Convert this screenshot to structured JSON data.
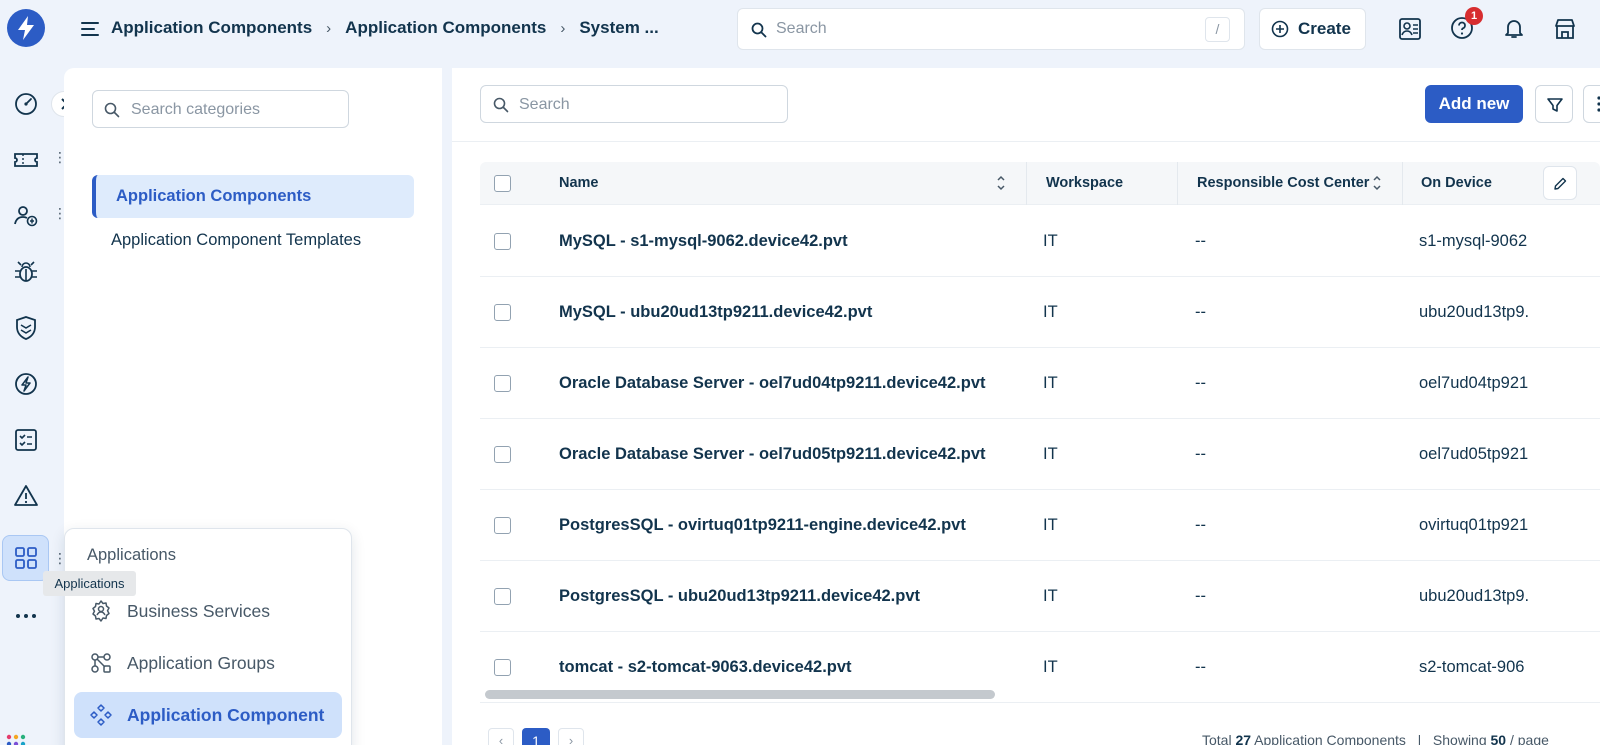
{
  "topbar": {
    "breadcrumb": [
      "Application Components",
      "Application Components",
      "System ..."
    ],
    "search_placeholder": "Search",
    "search_shortcut": "/",
    "create_label": "Create",
    "help_badge_count": "1"
  },
  "categories": {
    "search_placeholder": "Search categories",
    "items": [
      {
        "label": "Application Components",
        "active": true
      },
      {
        "label": "Application Component Templates",
        "active": false
      }
    ]
  },
  "main": {
    "search_placeholder": "Search",
    "add_new_label": "Add new",
    "columns": [
      "Name",
      "Workspace",
      "Responsible Cost Center",
      "On Device"
    ],
    "rows": [
      {
        "name": "MySQL - s1-mysql-9062.device42.pvt",
        "workspace": "IT",
        "cost_center": "--",
        "on_device": "s1-mysql-9062"
      },
      {
        "name": "MySQL - ubu20ud13tp9211.device42.pvt",
        "workspace": "IT",
        "cost_center": "--",
        "on_device": "ubu20ud13tp9."
      },
      {
        "name": "Oracle Database Server - oel7ud04tp9211.device42.pvt",
        "workspace": "IT",
        "cost_center": "--",
        "on_device": "oel7ud04tp921"
      },
      {
        "name": "Oracle Database Server - oel7ud05tp9211.device42.pvt",
        "workspace": "IT",
        "cost_center": "--",
        "on_device": "oel7ud05tp921"
      },
      {
        "name": "PostgresSQL - ovirtuq01tp9211-engine.device42.pvt",
        "workspace": "IT",
        "cost_center": "--",
        "on_device": "ovirtuq01tp921"
      },
      {
        "name": "PostgresSQL - ubu20ud13tp9211.device42.pvt",
        "workspace": "IT",
        "cost_center": "--",
        "on_device": "ubu20ud13tp9."
      },
      {
        "name": "tomcat - s2-tomcat-9063.device42.pvt",
        "workspace": "IT",
        "cost_center": "--",
        "on_device": "s2-tomcat-906"
      }
    ],
    "pagination": {
      "prev": "‹",
      "current_page": "1",
      "next": "›",
      "total_prefix": "Total",
      "total_count": "27",
      "total_suffix": "Application Components",
      "divider": "|",
      "showing_prefix": "Showing",
      "per_page": "50",
      "showing_suffix": "/ page"
    }
  },
  "flyout": {
    "title": "Applications",
    "tooltip": "Applications",
    "items": [
      {
        "label": "Business Services",
        "icon": "business-services-icon",
        "active": false
      },
      {
        "label": "Application Groups",
        "icon": "application-groups-icon",
        "active": false
      },
      {
        "label": "Application Component",
        "icon": "application-component-icon",
        "active": true
      }
    ]
  },
  "colors": {
    "primary": "#2c5cc5",
    "text": "#12344d",
    "muted": "#475867",
    "page_bg": "#eef3fb",
    "active_bg": "#cfe1fb",
    "badge": "#d72d30"
  }
}
